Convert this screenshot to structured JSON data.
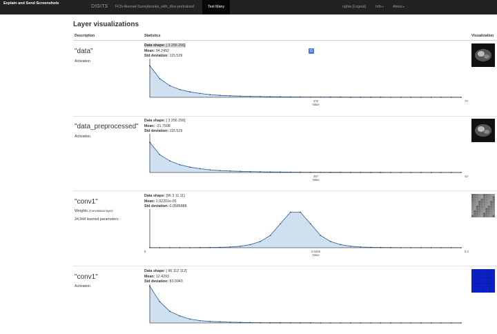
{
  "navbar": {
    "brand": "Explain and Send Screenshots",
    "app_name": "DIGITS",
    "job_name": "FCN-Alexnet-Sunnybrooke_with_dice-pretrained",
    "active_tab": "Test Many",
    "user": "nghia (Logout)",
    "info_label": "Info",
    "about_label": "About"
  },
  "page": {
    "title": "Layer visualizations",
    "columns": [
      "Description",
      "Statistics",
      "Visualization"
    ]
  },
  "layers": [
    {
      "name": "\"data\"",
      "type": "Activation",
      "type_note": "",
      "params": "",
      "shape_label": "Data shape:",
      "shape_value": "[ 3 256 256]",
      "mean_label": "Mean:",
      "mean_value": "94.2492",
      "std_label": "Std deviation:",
      "std_value": "115.529",
      "viz": "mri-slice",
      "histogram": {
        "x_ticks": [
          "",
          "375",
          "74"
        ],
        "xlabel": "Value",
        "values": [
          0.82,
          0.48,
          0.3,
          0.2,
          0.14,
          0.1,
          0.07,
          0.05,
          0.04,
          0.03,
          0.025,
          0.02,
          0.015,
          0.012,
          0.01,
          0.009,
          0.008,
          0.007,
          0.006,
          0.005,
          0.004,
          0.004,
          0.003,
          0.003,
          0.002,
          0.002,
          0.002,
          0.002,
          0.001,
          0.001,
          0.001,
          0.001
        ]
      }
    },
    {
      "name": "\"data_preprocessed\"",
      "type": "Activation",
      "type_note": "",
      "params": "",
      "shape_label": "Data shape:",
      "shape_value": "[ 3 256 256]",
      "mean_label": "Mean:",
      "mean_value": "-21.7508",
      "std_label": "Std deviation:",
      "std_value": "115.529",
      "viz": "mri-slice",
      "histogram": {
        "x_ticks": [
          "",
          "257",
          "43"
        ],
        "xlabel": "Value",
        "values": [
          0.78,
          0.46,
          0.3,
          0.2,
          0.14,
          0.1,
          0.07,
          0.05,
          0.04,
          0.03,
          0.025,
          0.02,
          0.015,
          0.012,
          0.01,
          0.009,
          0.008,
          0.007,
          0.006,
          0.005,
          0.004,
          0.004,
          0.003,
          0.003,
          0.002,
          0.002,
          0.002,
          0.002,
          0.001,
          0.001,
          0.001,
          0.001
        ]
      }
    },
    {
      "name": "\"conv1\"",
      "type": "Weights",
      "type_note": "(Convolution layer)",
      "params": "34,944 learned parameters",
      "shape_label": "Data shape:",
      "shape_value": "[96 3 11 11]",
      "mean_label": "Mean:",
      "mean_value": "1.02201e-05",
      "std_label": "Std deviation:",
      "std_value": "0.0585888",
      "viz": "filter-grid",
      "histogram": {
        "x_ticks": [
          "8",
          "0.0425",
          "0.4"
        ],
        "xlabel": "Value",
        "values": [
          0.001,
          0.001,
          0.001,
          0.001,
          0.002,
          0.003,
          0.005,
          0.01,
          0.02,
          0.04,
          0.08,
          0.16,
          0.32,
          0.62,
          0.92,
          0.92,
          0.62,
          0.32,
          0.16,
          0.08,
          0.04,
          0.02,
          0.01,
          0.005,
          0.003,
          0.002,
          0.001,
          0.001,
          0.001,
          0.001,
          0.001,
          0.001
        ]
      }
    },
    {
      "name": "\"conv1\"",
      "type": "Activation",
      "type_note": "",
      "params": "",
      "shape_label": "Data shape:",
      "shape_value": "[ 96 112 112]",
      "mean_label": "Mean:",
      "mean_value": "12.4293",
      "std_label": "Std deviation:",
      "std_value": "83.0943",
      "viz": "activation-map",
      "histogram": {
        "x_ticks": [
          "",
          "",
          ""
        ],
        "xlabel": "",
        "values": [
          0.95,
          0.55,
          0.3,
          0.18,
          0.1,
          0.06,
          0.04,
          0.03,
          0.02,
          0.015,
          0.01,
          0.008,
          0.006,
          0.005,
          0.004,
          0.003,
          0.003,
          0.002,
          0.002,
          0.002,
          0.001,
          0.001,
          0.001,
          0.001,
          0.001,
          0.001,
          0.001,
          0.001,
          0.001,
          0.001,
          0.001,
          0.001
        ]
      }
    }
  ]
}
